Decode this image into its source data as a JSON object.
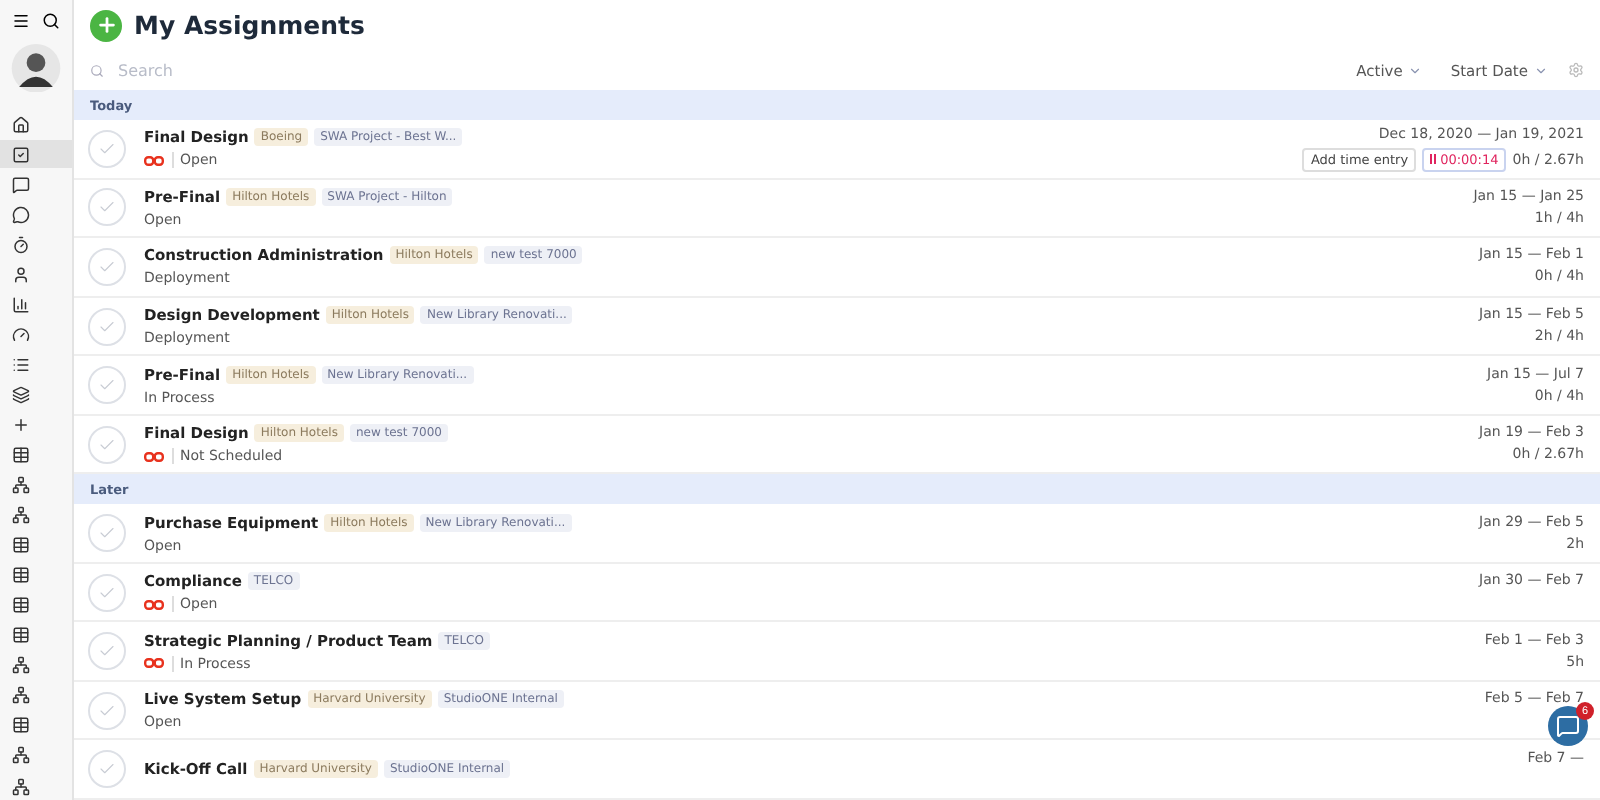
{
  "title": "My Assignments",
  "search": {
    "placeholder": "Search"
  },
  "filters": [
    {
      "label": "Active"
    },
    {
      "label": "Start Date"
    }
  ],
  "sidebar": {
    "items": [
      {
        "kind": "home",
        "selected": false
      },
      {
        "kind": "tasks",
        "selected": true
      },
      {
        "kind": "chat",
        "selected": false
      },
      {
        "kind": "message",
        "selected": false
      },
      {
        "kind": "timer",
        "selected": false
      },
      {
        "kind": "person",
        "selected": false
      },
      {
        "kind": "chart",
        "selected": false
      },
      {
        "kind": "gauge",
        "selected": false
      },
      {
        "kind": "list",
        "selected": false
      },
      {
        "kind": "layers",
        "selected": false
      },
      {
        "kind": "add",
        "selected": false
      },
      {
        "kind": "grid",
        "selected": false
      },
      {
        "kind": "tree",
        "selected": false
      },
      {
        "kind": "tree",
        "selected": false
      },
      {
        "kind": "grid",
        "selected": false
      },
      {
        "kind": "grid",
        "selected": false
      },
      {
        "kind": "grid",
        "selected": false
      },
      {
        "kind": "grid",
        "selected": false
      },
      {
        "kind": "tree",
        "selected": false
      },
      {
        "kind": "tree",
        "selected": false
      },
      {
        "kind": "grid",
        "selected": false
      },
      {
        "kind": "tree",
        "selected": false
      },
      {
        "kind": "tree",
        "selected": false
      }
    ]
  },
  "groups": [
    {
      "label": "Today",
      "rows": [
        {
          "title": "Final Design",
          "checked": false,
          "client": "Boeing",
          "project": "SWA Project - Best W...",
          "linked": true,
          "status": "Open",
          "dates": "Dec 18, 2020 — Jan 19, 2021",
          "hours": "0h / 2.67h",
          "time_entry": "Add time entry",
          "timer": "00:00:14"
        },
        {
          "title": "Pre-Final",
          "checked": false,
          "client": "Hilton Hotels",
          "project": "SWA Project - Hilton",
          "linked": false,
          "status": "Open",
          "dates": "Jan 15 — Jan 25",
          "hours": "1h / 4h"
        },
        {
          "title": "Construction Administration",
          "checked": false,
          "client": "Hilton Hotels",
          "project": "new test 7000",
          "linked": false,
          "status": "Deployment",
          "dates": "Jan 15 — Feb 1",
          "hours": "0h / 4h"
        },
        {
          "title": "Design Development",
          "checked": false,
          "client": "Hilton Hotels",
          "project": "New Library Renovati...",
          "linked": false,
          "status": "Deployment",
          "dates": "Jan 15 — Feb 5",
          "hours": "2h / 4h"
        },
        {
          "title": "Pre-Final",
          "checked": false,
          "client": "Hilton Hotels",
          "project": "New Library Renovati...",
          "linked": false,
          "status": "In Process",
          "dates": "Jan 15 — Jul 7",
          "hours": "0h / 4h"
        },
        {
          "title": "Final Design",
          "checked": false,
          "client": "Hilton Hotels",
          "project": "new test 7000",
          "linked": true,
          "status": "Not Scheduled",
          "dates": "Jan 19 — Feb 3",
          "hours": "0h / 2.67h"
        }
      ]
    },
    {
      "label": "Later",
      "rows": [
        {
          "title": "Purchase Equipment",
          "checked": false,
          "client": "Hilton Hotels",
          "project": "New Library Renovati...",
          "linked": false,
          "status": "Open",
          "dates": "Jan 29 — Feb 5",
          "hours": "2h"
        },
        {
          "title": "Compliance",
          "checked": false,
          "project": "TELCO",
          "linked": true,
          "status": "Open",
          "dates": "Jan 30 — Feb 7"
        },
        {
          "title": "Strategic Planning / Product Team",
          "checked": false,
          "project": "TELCO",
          "linked": true,
          "status": "In Process",
          "dates": "Feb 1 — Feb 3",
          "hours": "5h"
        },
        {
          "title": "Live System Setup",
          "checked": false,
          "client": "Harvard University",
          "project": "StudioONE Internal",
          "linked": false,
          "status": "Open",
          "dates": "Feb 5 — Feb 7"
        },
        {
          "title": "Kick-Off Call",
          "checked": false,
          "client": "Harvard University",
          "project": "StudioONE Internal",
          "linked": false,
          "dates": "Feb 7 —"
        }
      ]
    }
  ],
  "chat": {
    "badge": "6"
  }
}
